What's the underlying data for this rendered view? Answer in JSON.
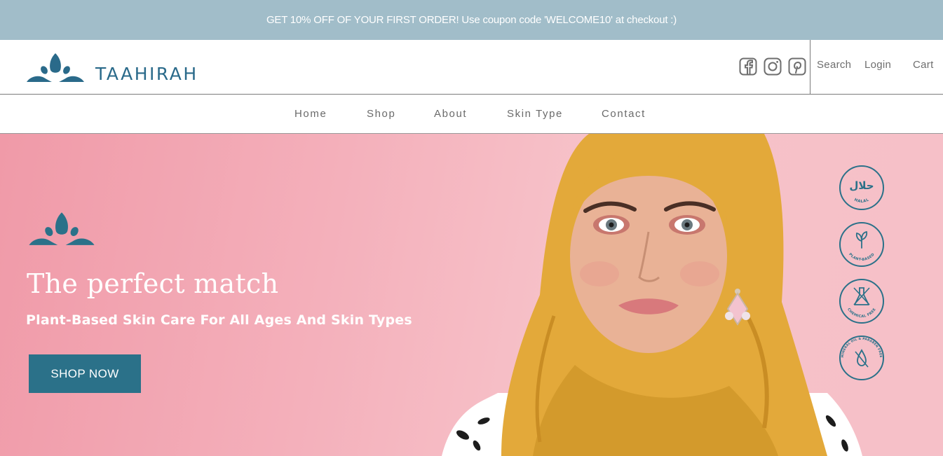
{
  "announcement": {
    "text": "GET 10% OFF OF YOUR FIRST ORDER! Use coupon code 'WELCOME10' at checkout :)"
  },
  "brand": {
    "name": "TAAHIRAH",
    "color": "#2a6a8a"
  },
  "header": {
    "socials": [
      {
        "icon": "facebook-icon"
      },
      {
        "icon": "instagram-icon"
      },
      {
        "icon": "pinterest-icon"
      }
    ],
    "search_label": "Search",
    "login_label": "Login",
    "cart_label": "Cart"
  },
  "nav": {
    "items": [
      {
        "label": "Home"
      },
      {
        "label": "Shop"
      },
      {
        "label": "About"
      },
      {
        "label": "Skin Type"
      },
      {
        "label": "Contact"
      }
    ]
  },
  "hero": {
    "title": "The perfect match",
    "subtitle": "Plant-Based Skin Care For All Ages And Skin Types",
    "cta_label": "SHOP NOW",
    "badges": [
      {
        "name": "halal-badge",
        "label": "HALAL",
        "glyph": "حلال"
      },
      {
        "name": "plant-based-badge",
        "label": "PLANT-BASED"
      },
      {
        "name": "chemical-free-badge",
        "label": "CHEMICAL FREE"
      },
      {
        "name": "mineral-oil-paraben-free-badge",
        "label": "MINERAL OIL & PARABEN FREE"
      }
    ]
  },
  "colors": {
    "announcement_bg": "#a1bdc9",
    "accent": "#2b7189",
    "hero_pink": "#f4b0bb",
    "scarf": "#e3a93a"
  }
}
